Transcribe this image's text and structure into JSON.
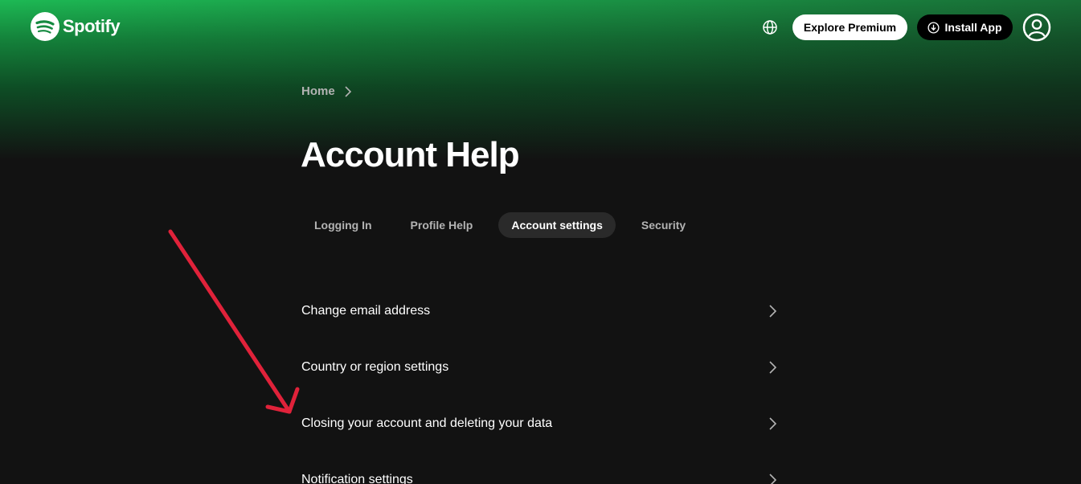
{
  "header": {
    "logo_text": "Spotify",
    "explore_premium_label": "Explore Premium",
    "install_app_label": "Install App"
  },
  "breadcrumb": {
    "home_label": "Home"
  },
  "page": {
    "title": "Account Help"
  },
  "tabs": [
    {
      "label": "Logging In",
      "active": false
    },
    {
      "label": "Profile Help",
      "active": false
    },
    {
      "label": "Account settings",
      "active": true
    },
    {
      "label": "Security",
      "active": false
    }
  ],
  "list": {
    "items": [
      {
        "label": "Change email address"
      },
      {
        "label": "Country or region settings"
      },
      {
        "label": "Closing your account and deleting your data"
      },
      {
        "label": "Notification settings"
      }
    ]
  },
  "colors": {
    "brand_green": "#1db954",
    "background": "#121212",
    "tab_active_bg": "#2a2a2a",
    "annotation_arrow": "#e0223a"
  },
  "icons": {
    "logo": "spotify-logo-icon",
    "language": "globe-icon",
    "install": "download-icon",
    "profile": "user-icon",
    "breadcrumb_separator": "chevron-right-icon",
    "list_chevron": "chevron-right-icon"
  }
}
